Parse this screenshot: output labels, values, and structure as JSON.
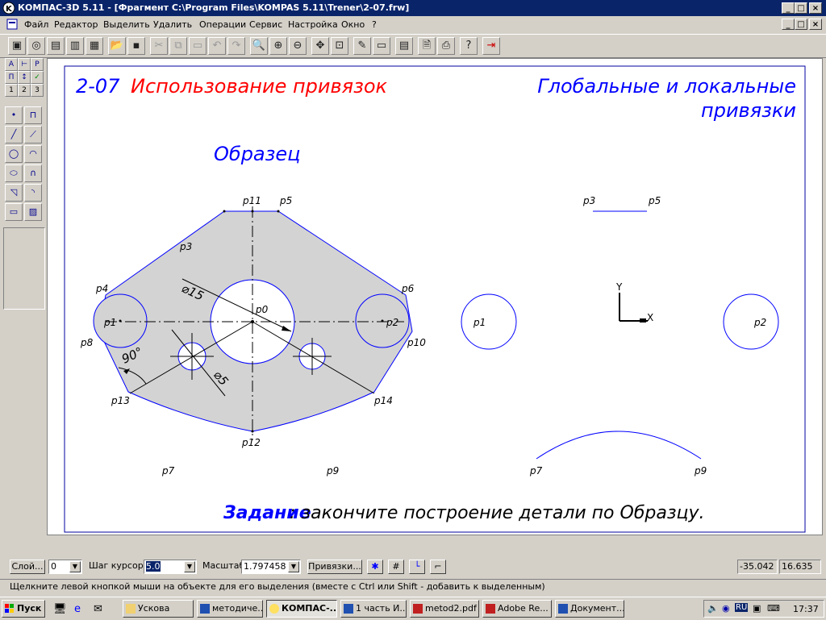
{
  "window": {
    "title": "КОМПАС-3D 5.11 - [Фрагмент C:\\Program Files\\KOMPAS 5.11\\Trener\\2-07.frw]",
    "controls": [
      "_",
      "□",
      "×"
    ]
  },
  "menu": {
    "items": [
      "Файл",
      "Редактор",
      "Выделить",
      "Удалить",
      "Операции",
      "Сервис",
      "Настройка",
      "Окно",
      "?"
    ]
  },
  "drawing": {
    "code": "2-07",
    "title": "Использование привязок",
    "heading_line1": "Глобальные и локальные",
    "heading_line2": "привязки",
    "sample_label": "Образец",
    "task_word": "Задание",
    "task_text": ": закончите построение детали по Образцу.",
    "dim_diameter_big": "⌀15",
    "dim_diameter_small": "⌀5",
    "dim_angle": "90°",
    "axis_y": "Y",
    "axis_x": "X",
    "points_left": [
      "p3",
      "p11",
      "p5",
      "p4",
      "p6",
      "p1",
      "p0",
      "p2",
      "p8",
      "p10",
      "p13",
      "p14",
      "p12",
      "p7",
      "p9"
    ],
    "points_right": [
      "p3",
      "p5",
      "p1",
      "p2",
      "p7",
      "p9"
    ],
    "colors": {
      "red": "#ff0000",
      "blue": "#0000ff",
      "fill": "#d3d3d3"
    }
  },
  "status_controls": {
    "layer_button": "Слой...",
    "layer_value": "0",
    "step_label": "Шаг курсора",
    "step_value": "5.0",
    "scale_label": "Масштаб",
    "scale_value": "1.797458",
    "snaps_button": "Привязки...",
    "coord_x": "-35.042",
    "coord_y": "16.635"
  },
  "status_hint": "Щелкните левой кнопкой мыши на объекте для его выделения (вместе с Ctrl или Shift - добавить к выделенным)",
  "taskbar": {
    "start": "Пуск",
    "tasks": [
      "Ускова",
      "методиче...",
      "КОМПАС-...",
      "1 часть И...",
      "metod2.pdf",
      "Adobe Re...",
      "Документ..."
    ],
    "lang": "RU",
    "clock": "17:37"
  }
}
